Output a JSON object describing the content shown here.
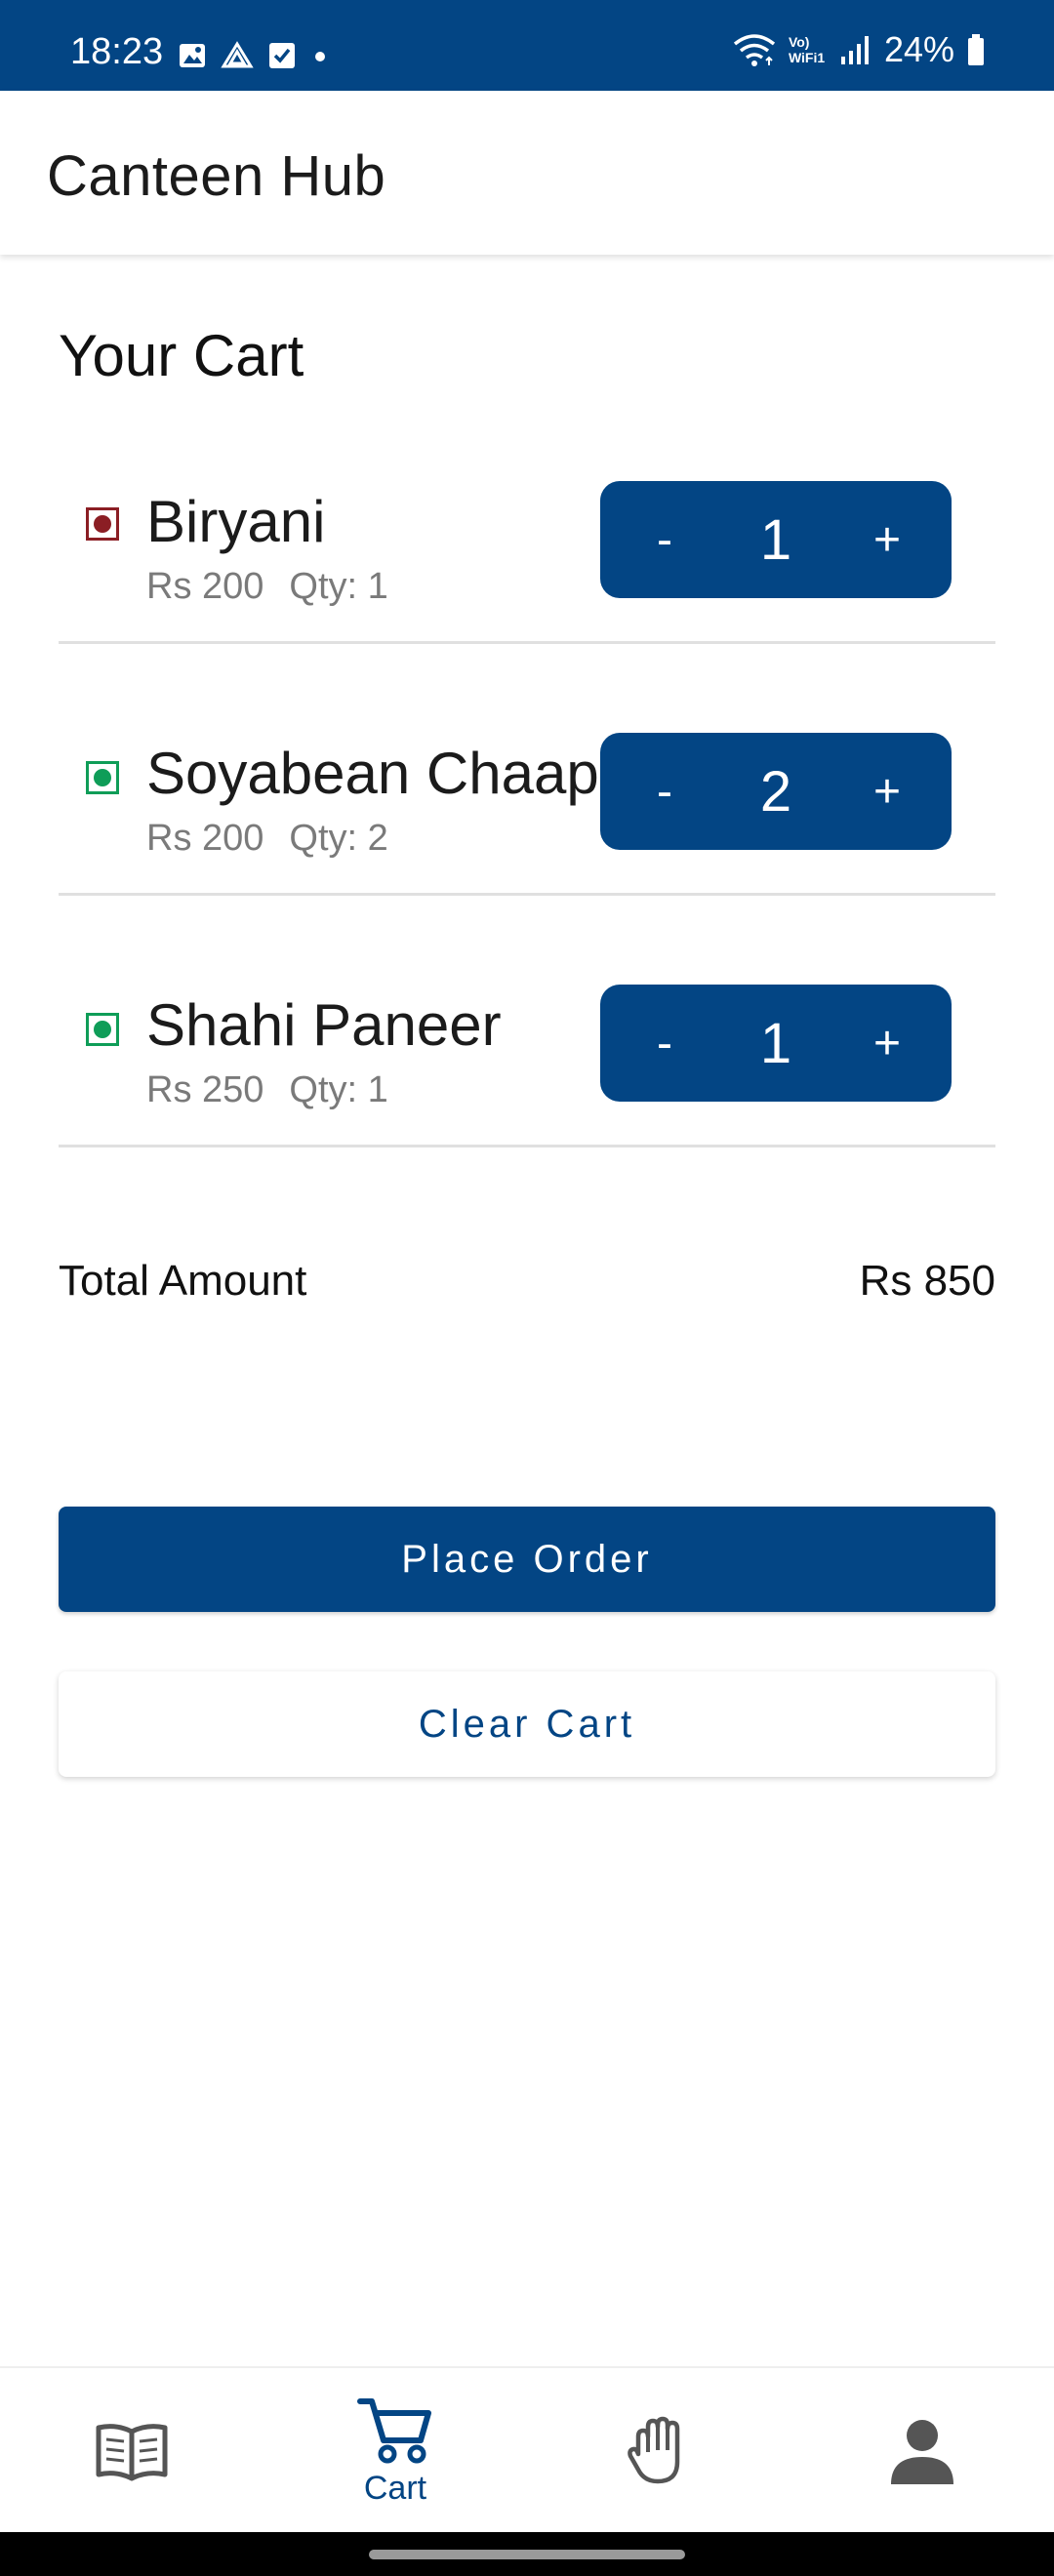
{
  "status_bar": {
    "time": "18:23",
    "battery": "24%",
    "network_label": "Vo) WiFi1",
    "background": "#034584"
  },
  "app_bar": {
    "title": "Canteen Hub"
  },
  "cart": {
    "title": "Your Cart",
    "items": [
      {
        "name": "Biryani",
        "price": "Rs 200",
        "qty_text": "Qty: 1",
        "quantity": "1",
        "diet": "non-veg",
        "diet_color": "#8b1e24"
      },
      {
        "name": "Soyabean Chaap",
        "price": "Rs 200",
        "qty_text": "Qty: 2",
        "quantity": "2",
        "diet": "veg",
        "diet_color": "#0f9d58"
      },
      {
        "name": "Shahi Paneer",
        "price": "Rs 250",
        "qty_text": "Qty: 1",
        "quantity": "1",
        "diet": "veg",
        "diet_color": "#0f9d58"
      }
    ],
    "decrement_label": "-",
    "increment_label": "+",
    "total_label": "Total Amount",
    "total_value": "Rs 850"
  },
  "actions": {
    "place_order": "Place Order",
    "clear_cart": "Clear Cart"
  },
  "bottom_nav": {
    "items": [
      {
        "icon": "menu-book-icon",
        "label": ""
      },
      {
        "icon": "cart-icon",
        "label": "Cart",
        "active": true
      },
      {
        "icon": "hand-icon",
        "label": ""
      },
      {
        "icon": "profile-icon",
        "label": ""
      }
    ]
  },
  "colors": {
    "accent": "#034584",
    "muted_text": "#7a7a7a",
    "divider": "#e0e0e0"
  }
}
